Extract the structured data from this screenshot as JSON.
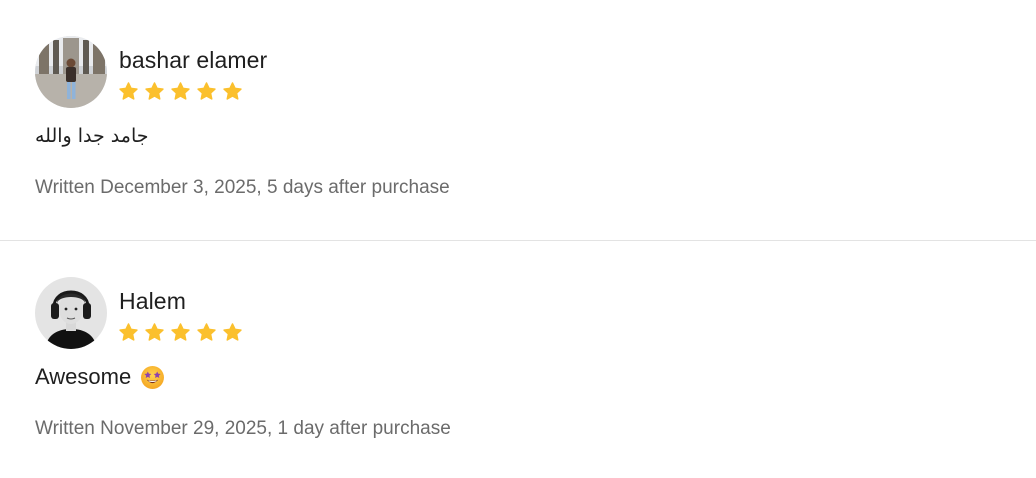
{
  "colors": {
    "star": "#FBC02D",
    "meta_text": "#6b6b6b",
    "divider": "#e3e3e3"
  },
  "reviews": [
    {
      "author": "bashar elamer",
      "rating": 5,
      "rating_max": 5,
      "body": "جامد جدا والله",
      "meta": "Written December 3, 2025, 5 days after purchase",
      "avatar_icon": "avatar-photo-person-standing"
    },
    {
      "author": "Halem",
      "rating": 5,
      "rating_max": 5,
      "body": "Awesome",
      "body_emoji": "star-struck-emoji",
      "meta": "Written November 29, 2025, 1 day after purchase",
      "avatar_icon": "avatar-photo-person-headphones"
    }
  ]
}
